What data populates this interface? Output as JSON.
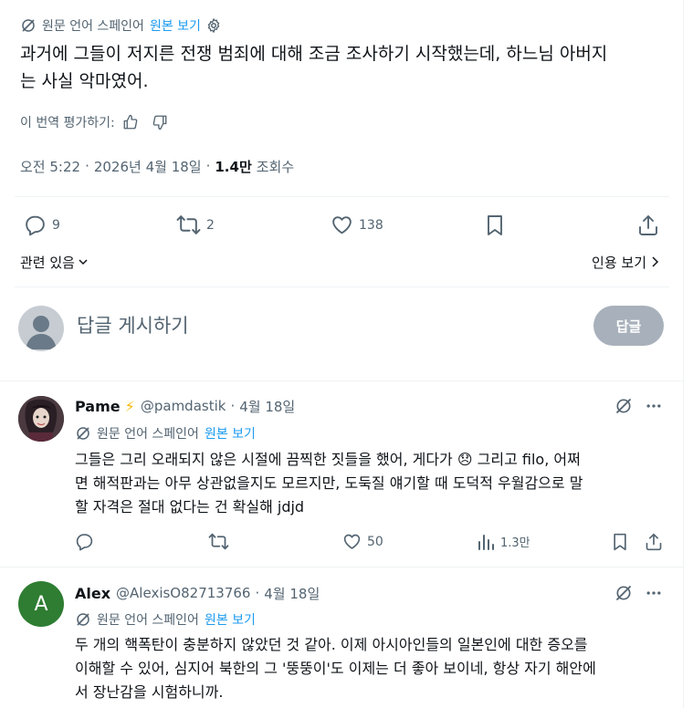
{
  "main_post": {
    "translation_source": "원문 언어 스페인어",
    "show_original": "원본 보기",
    "text_line1": "과거에 그들이 저지른 전쟁 범죄에 대해 조금 조사하기 시작했는데, 하느님 아버지",
    "text_line2": "는 사실 악마였어.",
    "rate_translation": "이 번역 평가하기:",
    "time": "오전 5:22",
    "date": "2026년 4월 18일",
    "views_count": "1.4만",
    "views_label": "조회수",
    "replies": "9",
    "reposts": "2",
    "likes": "138",
    "related": "관련 있음",
    "view_quotes": "인용 보기"
  },
  "composer": {
    "placeholder": "답글 게시하기",
    "reply_button": "답글"
  },
  "replies": [
    {
      "name": "Pame",
      "emoji": "⚡",
      "handle": "@pamdastik",
      "sep": "·",
      "date": "4월 18일",
      "translation_source": "원문 언어 스페인어",
      "show_original": "원본 보기",
      "line1": "그들은 그리 오래되지 않은 시절에 끔찍한 짓들을 했어, 게다가",
      "line1_emoji": "😞",
      "line1_after": " 그리고 filo, 어쩌",
      "line2": "면 해적판과는 아무 상관없을지도 모르지만, 도둑질 얘기할 때 도덕적 우월감으로 말",
      "line3": "할 자격은 절대 없다는 건 확실해 jdjd",
      "replies": "",
      "reposts": "",
      "likes": "50",
      "views": "1.3만"
    },
    {
      "name": "Alex",
      "avatar_letter": "A",
      "handle": "@AlexisO82713766",
      "sep": "·",
      "date": "4월 18일",
      "translation_source": "원문 언어 스페인어",
      "show_original": "원본 보기",
      "line1": "두 개의 핵폭탄이 충분하지 않았던 것 같아. 이제 아시아인들의 일본인에 대한 증오를",
      "line2": "이해할 수 있어, 심지어 북한의 그 '뚱뚱이'도 이제는 더 좋아 보이네, 항상 자기 해안에",
      "line3": "서 장난감을 시험하니까."
    }
  ],
  "colors": {
    "accent": "#1d9bf0",
    "muted": "#536471",
    "reply_button_bg": "#8b98a5",
    "alex_avatar": "#2e7d32"
  }
}
